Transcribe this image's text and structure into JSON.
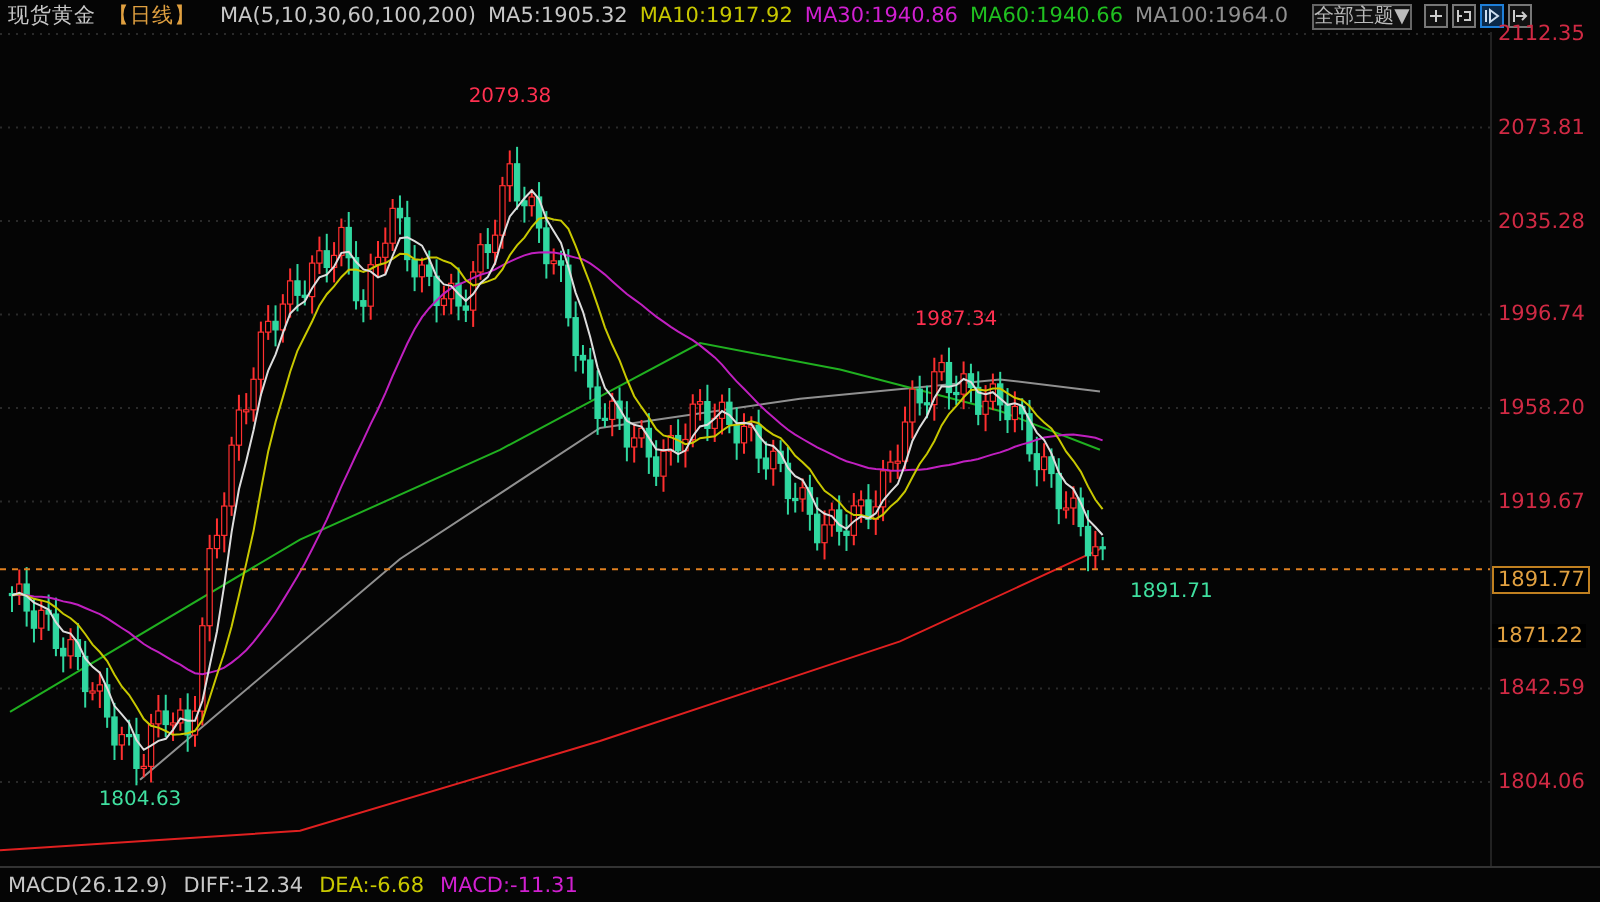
{
  "header": {
    "symbol": "现货黄金",
    "period": "【日线】",
    "indicator": "MA(5,10,30,60,100,200)",
    "ma_values": [
      {
        "label": "MA5:1905.32",
        "color": "#c8c8c8"
      },
      {
        "label": "MA10:1917.92",
        "color": "#c8c800"
      },
      {
        "label": "MA30:1940.86",
        "color": "#d020d0"
      },
      {
        "label": "MA60:1940.66",
        "color": "#20c020"
      },
      {
        "label": "MA100:1964.0",
        "color": "#909090"
      }
    ]
  },
  "toolbar": {
    "theme_select": "全部主题▼",
    "tools": [
      {
        "selected": false
      },
      {
        "selected": false
      },
      {
        "selected": true
      },
      {
        "selected": false
      }
    ]
  },
  "chart": {
    "y_axis_labels": [
      "2112.35",
      "2073.81",
      "2035.28",
      "1996.74",
      "1958.20",
      "1919.67",
      "1842.59",
      "1804.06"
    ],
    "annotations": [
      {
        "text": "2079.38",
        "kind": "high"
      },
      {
        "text": "1987.34",
        "kind": "high"
      },
      {
        "text": "1804.63",
        "kind": "low"
      },
      {
        "text": "1891.71",
        "kind": "low"
      }
    ],
    "last_price": "1891.77",
    "price_label": "1871.22"
  },
  "macd": {
    "label": "MACD(26.12.9)",
    "values": [
      {
        "label": "DIFF:-12.34",
        "color": "#c8c8c8"
      },
      {
        "label": "DEA:-6.68",
        "color": "#c8c800"
      },
      {
        "label": "MACD:-11.31",
        "color": "#d020d0"
      }
    ]
  }
}
